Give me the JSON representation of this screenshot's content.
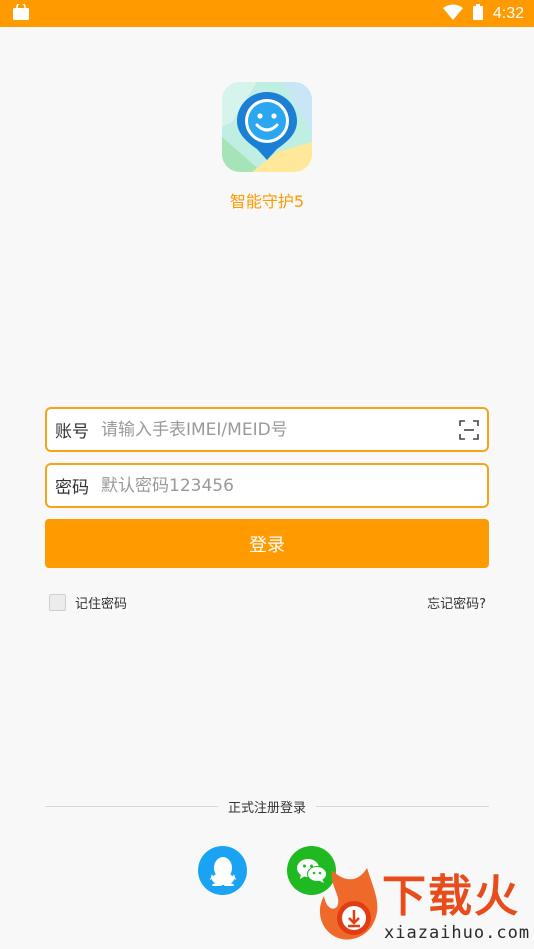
{
  "status_bar": {
    "time": "4:32",
    "icons": [
      "bag-icon",
      "wifi-icon",
      "battery-icon"
    ],
    "background": "#ff9a00"
  },
  "app": {
    "name": "智能守护5",
    "logo_icon": "smiley-map-pin-icon"
  },
  "form": {
    "account": {
      "label": "账号",
      "value": "",
      "placeholder": "请输入手表IMEI/MEID号",
      "scan_icon": "scan-icon"
    },
    "password": {
      "label": "密码",
      "value": "",
      "placeholder": "默认密码123456"
    },
    "login_label": "登录",
    "remember_label": "记住密码",
    "remember_checked": false,
    "forgot_label": "忘记密码?"
  },
  "register": {
    "divider_label": "正式注册登录",
    "providers": [
      {
        "name": "qq",
        "icon": "qq-penguin-icon",
        "color": "#1aa3f2"
      },
      {
        "name": "wechat",
        "icon": "wechat-icon",
        "color": "#1fb922"
      }
    ]
  },
  "watermark": {
    "brand": "下载火",
    "site": "xiazaihuo.com",
    "icon": "flame-download-icon"
  },
  "colors": {
    "accent": "#ff9a00",
    "field_border": "#f5a418"
  }
}
